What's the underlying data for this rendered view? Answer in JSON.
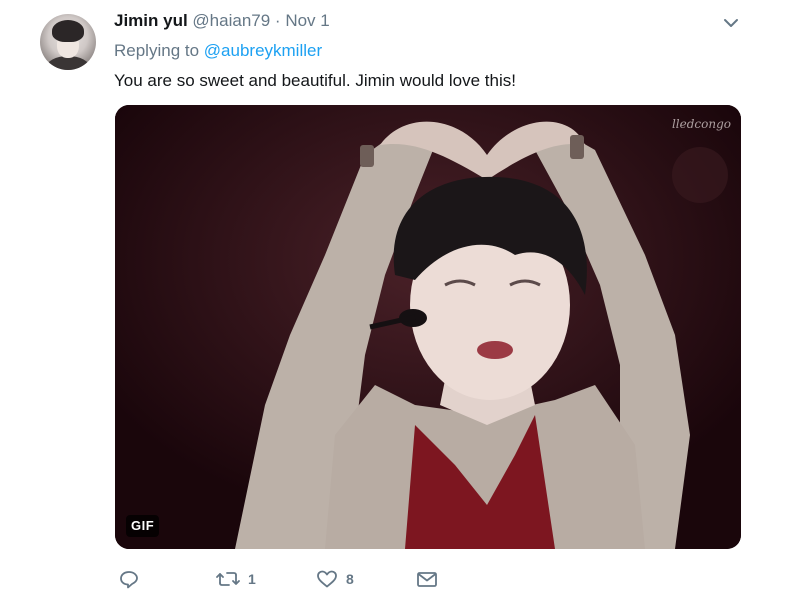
{
  "tweet": {
    "author_name": "Jimin yul",
    "handle": "@haian79",
    "separator": "·",
    "time": "Nov 1",
    "reply_prefix": "Replying to ",
    "reply_to": "@aubreykmiller",
    "text": "You are so sweet and beautiful. Jimin would love this!",
    "media": {
      "badge": "GIF",
      "watermark": "lledcongo"
    }
  },
  "actions": {
    "reply_count": "",
    "retweet_count": "1",
    "like_count": "8",
    "dm_count": ""
  },
  "icons": {
    "caret": "chevron-down-icon",
    "reply": "reply-icon",
    "retweet": "retweet-icon",
    "like": "heart-icon",
    "dm": "envelope-icon"
  },
  "colors": {
    "link": "#1da1f2",
    "muted": "#657786",
    "text": "#14171a"
  }
}
